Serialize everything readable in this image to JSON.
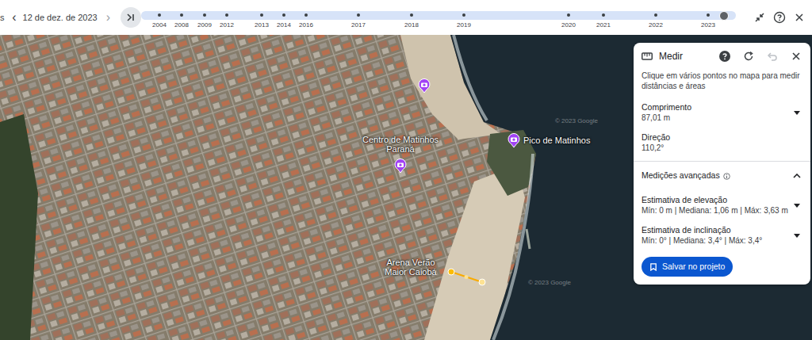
{
  "top_bar": {
    "cut_label": "s",
    "prev_icon": "‹",
    "date": "12 de dez. de 2023",
    "next_icon": "›"
  },
  "timeline": {
    "years": [
      "2004",
      "2008",
      "2009",
      "2012",
      "2013",
      "2014",
      "2016",
      "2017",
      "2018",
      "2019",
      "2020",
      "2021",
      "2022",
      "2023"
    ],
    "level": 0.98
  },
  "map": {
    "places": [
      {
        "kind": "pin"
      },
      {
        "kind": "pin-right",
        "label": "Pico de Matinhos"
      },
      {
        "kind": "pin-above",
        "label": "Centro de Matinhos Paraná"
      },
      {
        "kind": "label",
        "label": "Arena Verão Maior Caiobá"
      }
    ],
    "watermarks": [
      "© 2023 Google",
      "© 2023 Google"
    ]
  },
  "measure_panel": {
    "title": "Medir",
    "undo_disabled": true,
    "hint": "Clique em vários pontos no mapa para medir distâncias e áreas",
    "length": {
      "label": "Comprimento",
      "value": "87,01 m",
      "expanded": false
    },
    "direction": {
      "label": "Direção",
      "value": "110,2°"
    },
    "advanced": {
      "title": "Medições avançadas",
      "expanded": true,
      "items": [
        {
          "label": "Estimativa de elevação",
          "value": "Mín: 0 m | Mediana: 1,06 m | Máx: 3,63 m",
          "expanded": false
        },
        {
          "label": "Estimativa de inclinação",
          "value": "Mín: 0° | Mediana: 3,4° | Máx: 3,4°",
          "expanded": false
        }
      ]
    },
    "save_button": "Salvar no projeto"
  }
}
